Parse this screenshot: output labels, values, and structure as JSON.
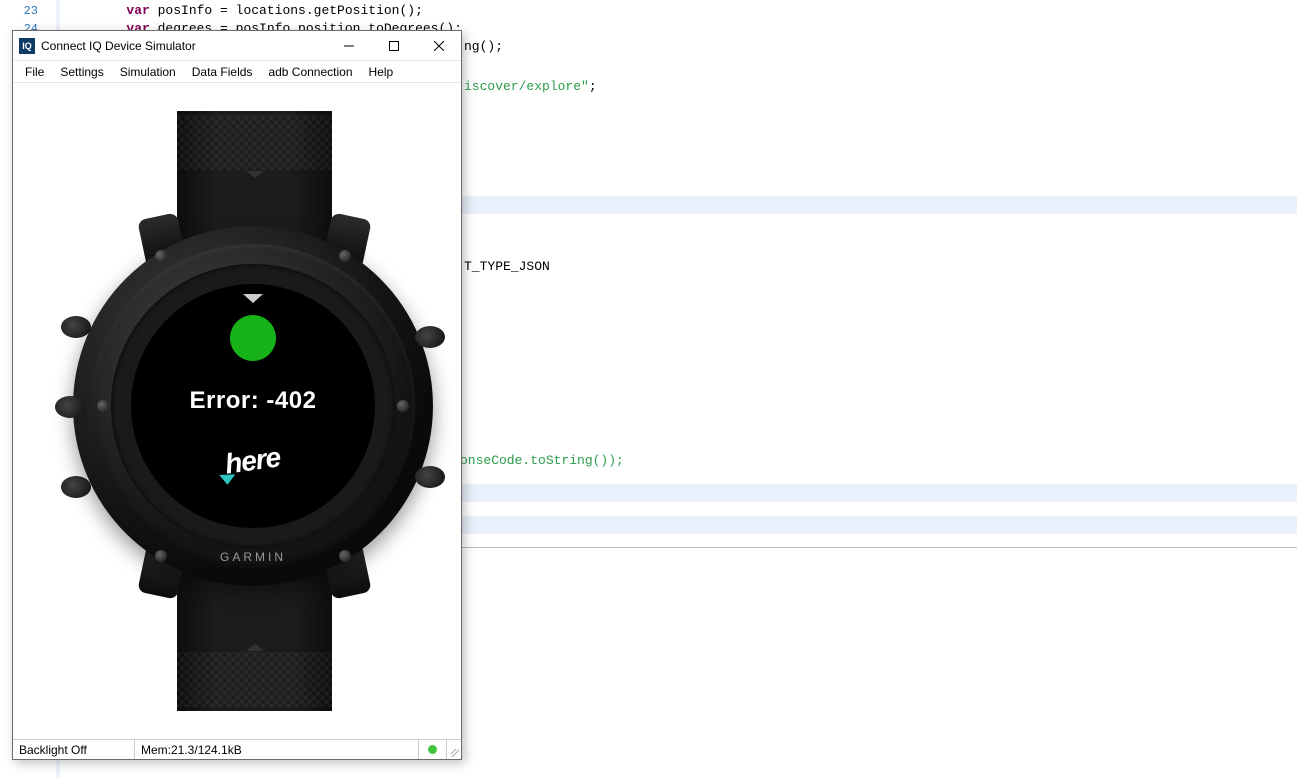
{
  "editor": {
    "gutter": [
      "23",
      "24"
    ],
    "lines": [
      {
        "indent": "        ",
        "prefix_kw": "var",
        "text": " posInfo = locations.getPosition();"
      },
      {
        "indent": "        ",
        "prefix_kw": "var",
        "text": " degrees = posInfo.position.toDegrees();"
      }
    ],
    "fragments": {
      "ng": "ng();",
      "discover_path": "iscover/explore\"",
      "semicolon": ";",
      "json_type": "T_TYPE_JSON",
      "response_tail": "onseCode.toString());"
    }
  },
  "simulator": {
    "title": "Connect IQ Device Simulator",
    "app_icon_text": "IQ",
    "menus": [
      "File",
      "Settings",
      "Simulation",
      "Data Fields",
      "adb Connection",
      "Help"
    ],
    "status": {
      "backlight": "Backlight Off",
      "mem": "Mem:21.3/124.1kB"
    }
  },
  "watch": {
    "error_text": "Error: -402",
    "logo_text": "here",
    "brand": "GARMIN"
  }
}
